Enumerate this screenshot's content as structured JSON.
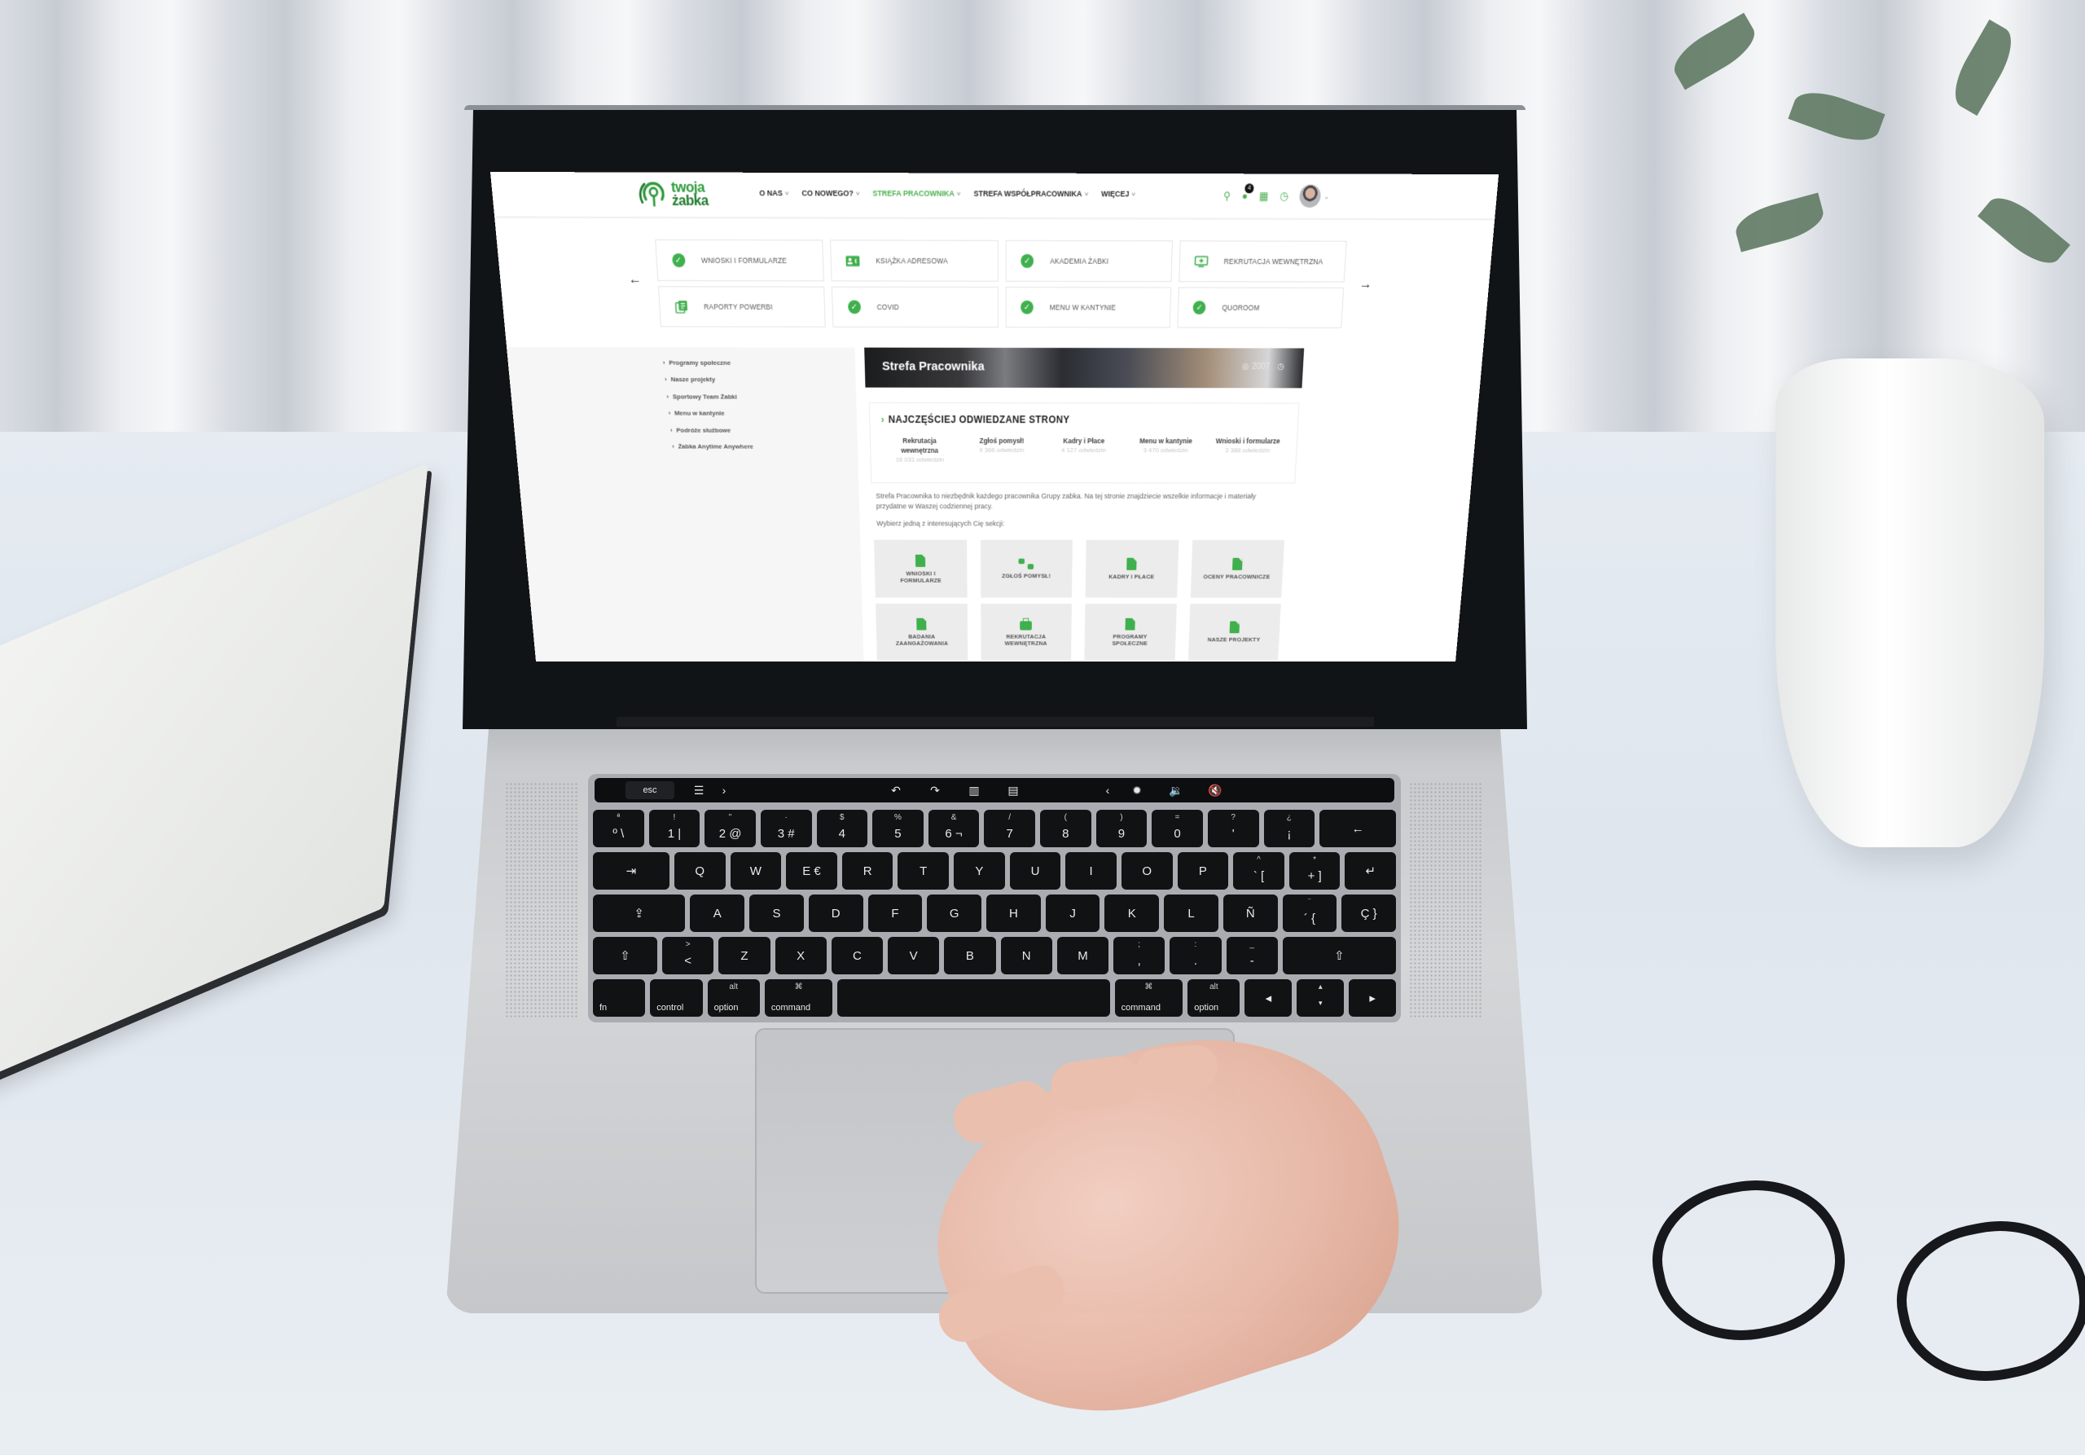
{
  "site": {
    "logo": {
      "line1": "twoja",
      "line2": "żabka"
    },
    "nav": [
      {
        "label": "O NAS",
        "active": false
      },
      {
        "label": "CO NOWEGO?",
        "active": false
      },
      {
        "label": "STREFA PRACOWNIKA",
        "active": true
      },
      {
        "label": "STREFA WSPÓŁPRACOWNIKA",
        "active": false
      },
      {
        "label": "WIĘCEJ",
        "active": false
      }
    ],
    "header_icons": {
      "search": "search-icon",
      "notifications": "chat-bubble-icon",
      "notification_count": "4",
      "apps": "grid-icon",
      "bookmarks": "bookmark-icon",
      "profile": "avatar"
    },
    "quick_links": {
      "prev_label": "←",
      "next_label": "→",
      "items": [
        {
          "label": "WNIOSKI I FORMULARZE",
          "icon": "check-circle-icon"
        },
        {
          "label": "KSIĄŻKA ADRESOWA",
          "icon": "contact-card-icon"
        },
        {
          "label": "AKADEMIA ŻABKI",
          "icon": "check-circle-icon"
        },
        {
          "label": "REKRUTACJA WEWNĘTRZNA",
          "icon": "monitor-plus-icon"
        },
        {
          "label": "RAPORTY POWERBI",
          "icon": "report-stack-icon"
        },
        {
          "label": "COVID",
          "icon": "check-circle-icon"
        },
        {
          "label": "MENU W KANTYNIE",
          "icon": "check-circle-icon"
        },
        {
          "label": "QUOROOM",
          "icon": "check-circle-icon"
        }
      ]
    },
    "sidebar": {
      "items": [
        "Programy społeczne",
        "Nasze projekty",
        "Sportowy Team Żabki",
        "Menu w kantynie",
        "Podróże służbowe",
        "Żabka Anytime Anywhere"
      ]
    },
    "hero": {
      "title": "Strefa Pracownika",
      "views": "2007"
    },
    "most_visited": {
      "title": "NAJCZĘŚCIEJ ODWIEDZANE STRONY",
      "items": [
        {
          "name": "Rekrutacja wewnętrzna",
          "count": "16 031 odwiedzin"
        },
        {
          "name": "Zgłoś pomysł!",
          "count": "9 366 odwiedzin"
        },
        {
          "name": "Kadry i Płace",
          "count": "4 127 odwiedzin"
        },
        {
          "name": "Menu w kantynie",
          "count": "3 470 odwiedzin"
        },
        {
          "name": "Wnioski i formularze",
          "count": "3 388 odwiedzin"
        }
      ]
    },
    "intro": {
      "paragraph": "Strefa Pracownika to niezbędnik każdego pracownika Grupy zabka. Na tej stronie znajdziecie wszelkie informacje i materiały przydatne w Waszej codziennej pracy.",
      "prompt": "Wybierz jedną z interesujących Cię sekcji:"
    },
    "sections": [
      {
        "label": "WNIOSKI I FORMULARZE",
        "icon": "doc"
      },
      {
        "label": "ZGŁOŚ POMYSŁ!",
        "icon": "thumbs"
      },
      {
        "label": "KADRY I PŁACE",
        "icon": "doc"
      },
      {
        "label": "OCENY PRACOWNICZE",
        "icon": "doc"
      },
      {
        "label": "BADANIA ZAANGAŻOWANIA",
        "icon": "doc"
      },
      {
        "label": "REKRUTACJA WEWNĘTRZNA",
        "icon": "bag"
      },
      {
        "label": "PROGRAMY SPOŁECZNE",
        "icon": "doc"
      },
      {
        "label": "NASZE PROJEKTY",
        "icon": "doc"
      }
    ],
    "colors": {
      "brand_green": "#3fb04d",
      "brand_dark_green": "#1f7a2c",
      "active_nav": "#4cb050"
    }
  },
  "keyboard": {
    "touchbar": {
      "esc": "esc",
      "controls": [
        "settings-sliders-icon",
        "chevron-right-icon",
        "rotate-left-icon",
        "rotate-right-icon",
        "split-view-icon",
        "crop-icon",
        "chevron-left-icon",
        "brightness-icon",
        "volume-icon",
        "mute-icon"
      ]
    },
    "rows": [
      [
        [
          "ª",
          "º \\"
        ],
        [
          "!",
          "1 |"
        ],
        [
          "\"",
          "2 @"
        ],
        [
          "·",
          "3 #"
        ],
        [
          "$",
          "4"
        ],
        [
          "%",
          "5"
        ],
        [
          "&",
          "6 ¬"
        ],
        [
          "/",
          "7"
        ],
        [
          "(",
          "8"
        ],
        [
          ")",
          "9"
        ],
        [
          "=",
          "0"
        ],
        [
          "?",
          "'"
        ],
        [
          "¿",
          "¡"
        ],
        [
          "",
          "←"
        ]
      ],
      [
        [
          "",
          "⇥"
        ],
        [
          "",
          "Q"
        ],
        [
          "",
          "W"
        ],
        [
          "",
          "E €"
        ],
        [
          "",
          "R"
        ],
        [
          "",
          "T"
        ],
        [
          "",
          "Y"
        ],
        [
          "",
          "U"
        ],
        [
          "",
          "I"
        ],
        [
          "",
          "O"
        ],
        [
          "",
          "P"
        ],
        [
          "^",
          "` ["
        ],
        [
          "*",
          "+ ]"
        ],
        [
          "",
          "↵"
        ]
      ],
      [
        [
          "",
          "⇪"
        ],
        [
          "",
          "A"
        ],
        [
          "",
          "S"
        ],
        [
          "",
          "D"
        ],
        [
          "",
          "F"
        ],
        [
          "",
          "G"
        ],
        [
          "",
          "H"
        ],
        [
          "",
          "J"
        ],
        [
          "",
          "K"
        ],
        [
          "",
          "L"
        ],
        [
          "",
          "Ñ"
        ],
        [
          "¨",
          "´ {"
        ],
        [
          "",
          "Ç }"
        ]
      ],
      [
        [
          "",
          "⇧"
        ],
        [
          ">",
          "<"
        ],
        [
          "",
          "Z"
        ],
        [
          "",
          "X"
        ],
        [
          "",
          "C"
        ],
        [
          "",
          "V"
        ],
        [
          "",
          "B"
        ],
        [
          "",
          "N"
        ],
        [
          "",
          "M"
        ],
        [
          ";",
          ","
        ],
        [
          ":",
          "."
        ],
        [
          "_",
          "-"
        ],
        [
          "",
          "⇧"
        ]
      ],
      [
        [
          "",
          "fn"
        ],
        [
          "",
          "control"
        ],
        [
          "alt",
          "option"
        ],
        [
          "⌘",
          "command"
        ],
        [
          "",
          ""
        ],
        [
          "⌘",
          "command"
        ],
        [
          "alt",
          "option"
        ],
        [
          "",
          "◂"
        ],
        [
          "▴",
          "▾"
        ],
        [
          "",
          "▸"
        ]
      ]
    ]
  }
}
